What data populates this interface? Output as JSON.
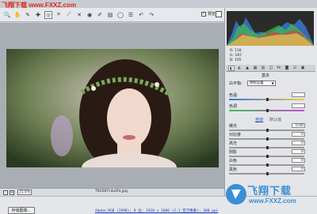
{
  "watermark": {
    "site": "飞翔下载 www.FXXZ.com"
  },
  "toolbar": {
    "tools": [
      {
        "name": "zoom-tool-icon",
        "glyph": "🔍"
      },
      {
        "name": "hand-tool-icon",
        "glyph": "✋"
      },
      {
        "name": "eyedropper-icon",
        "glyph": "✎"
      },
      {
        "name": "color-sampler-icon",
        "glyph": "✚"
      },
      {
        "name": "target-adjust-icon",
        "glyph": "◎"
      },
      {
        "name": "crop-icon",
        "glyph": "⌗"
      },
      {
        "name": "straighten-icon",
        "glyph": "⟋"
      },
      {
        "name": "spot-removal-icon",
        "glyph": "✕"
      },
      {
        "name": "red-eye-icon",
        "glyph": "◉"
      },
      {
        "name": "brush-icon",
        "glyph": "✐"
      },
      {
        "name": "gradient-filter-icon",
        "glyph": "▤"
      },
      {
        "name": "radial-filter-icon",
        "glyph": "◯"
      },
      {
        "name": "preferences-icon",
        "glyph": "☰"
      },
      {
        "name": "rotate-left-icon",
        "glyph": "↶"
      },
      {
        "name": "rotate-right-icon",
        "glyph": "↷"
      }
    ],
    "preview_label": "预览",
    "preview_checked": "✓"
  },
  "status": {
    "zoom_minus": "-",
    "zoom_plus": "+",
    "zoom_value": "25.6%",
    "filename": "TK0587c4e2fa.jpg"
  },
  "footer": {
    "save_label": "存储图像...",
    "workflow_link": "Adobe RGB (1998); 8 位; 1920 x 1080 (2.1 百万像素); 300 ppi"
  },
  "readout": {
    "r": "R:  116",
    "g": "G:  187",
    "b": "B:  105"
  },
  "panel": {
    "section_title": "基本",
    "white_balance_label": "白平衡:",
    "white_balance_value": "原照设置",
    "sliders": [
      {
        "label": "色温",
        "value": "",
        "pos": 0.5
      },
      {
        "label": "色调",
        "value": "",
        "pos": 0.5
      },
      {
        "label": "曝光",
        "value": "0.00",
        "pos": 0.5
      },
      {
        "label": "对比度",
        "value": "0",
        "pos": 0.5
      },
      {
        "label": "高光",
        "value": "0",
        "pos": 0.5
      },
      {
        "label": "阴影",
        "value": "0",
        "pos": 0.5
      },
      {
        "label": "白色",
        "value": "0",
        "pos": 0.5
      },
      {
        "label": "黑色",
        "value": "0",
        "pos": 0.5
      }
    ],
    "link_auto": "自动",
    "link_default": "默认值"
  },
  "logo": {
    "text": "飞翔下载",
    "url": "www.FXXZ.com"
  },
  "colors": {
    "accent": "#1a3fb4",
    "logo": "#3a8fd6",
    "watermark": "#e0261a"
  }
}
